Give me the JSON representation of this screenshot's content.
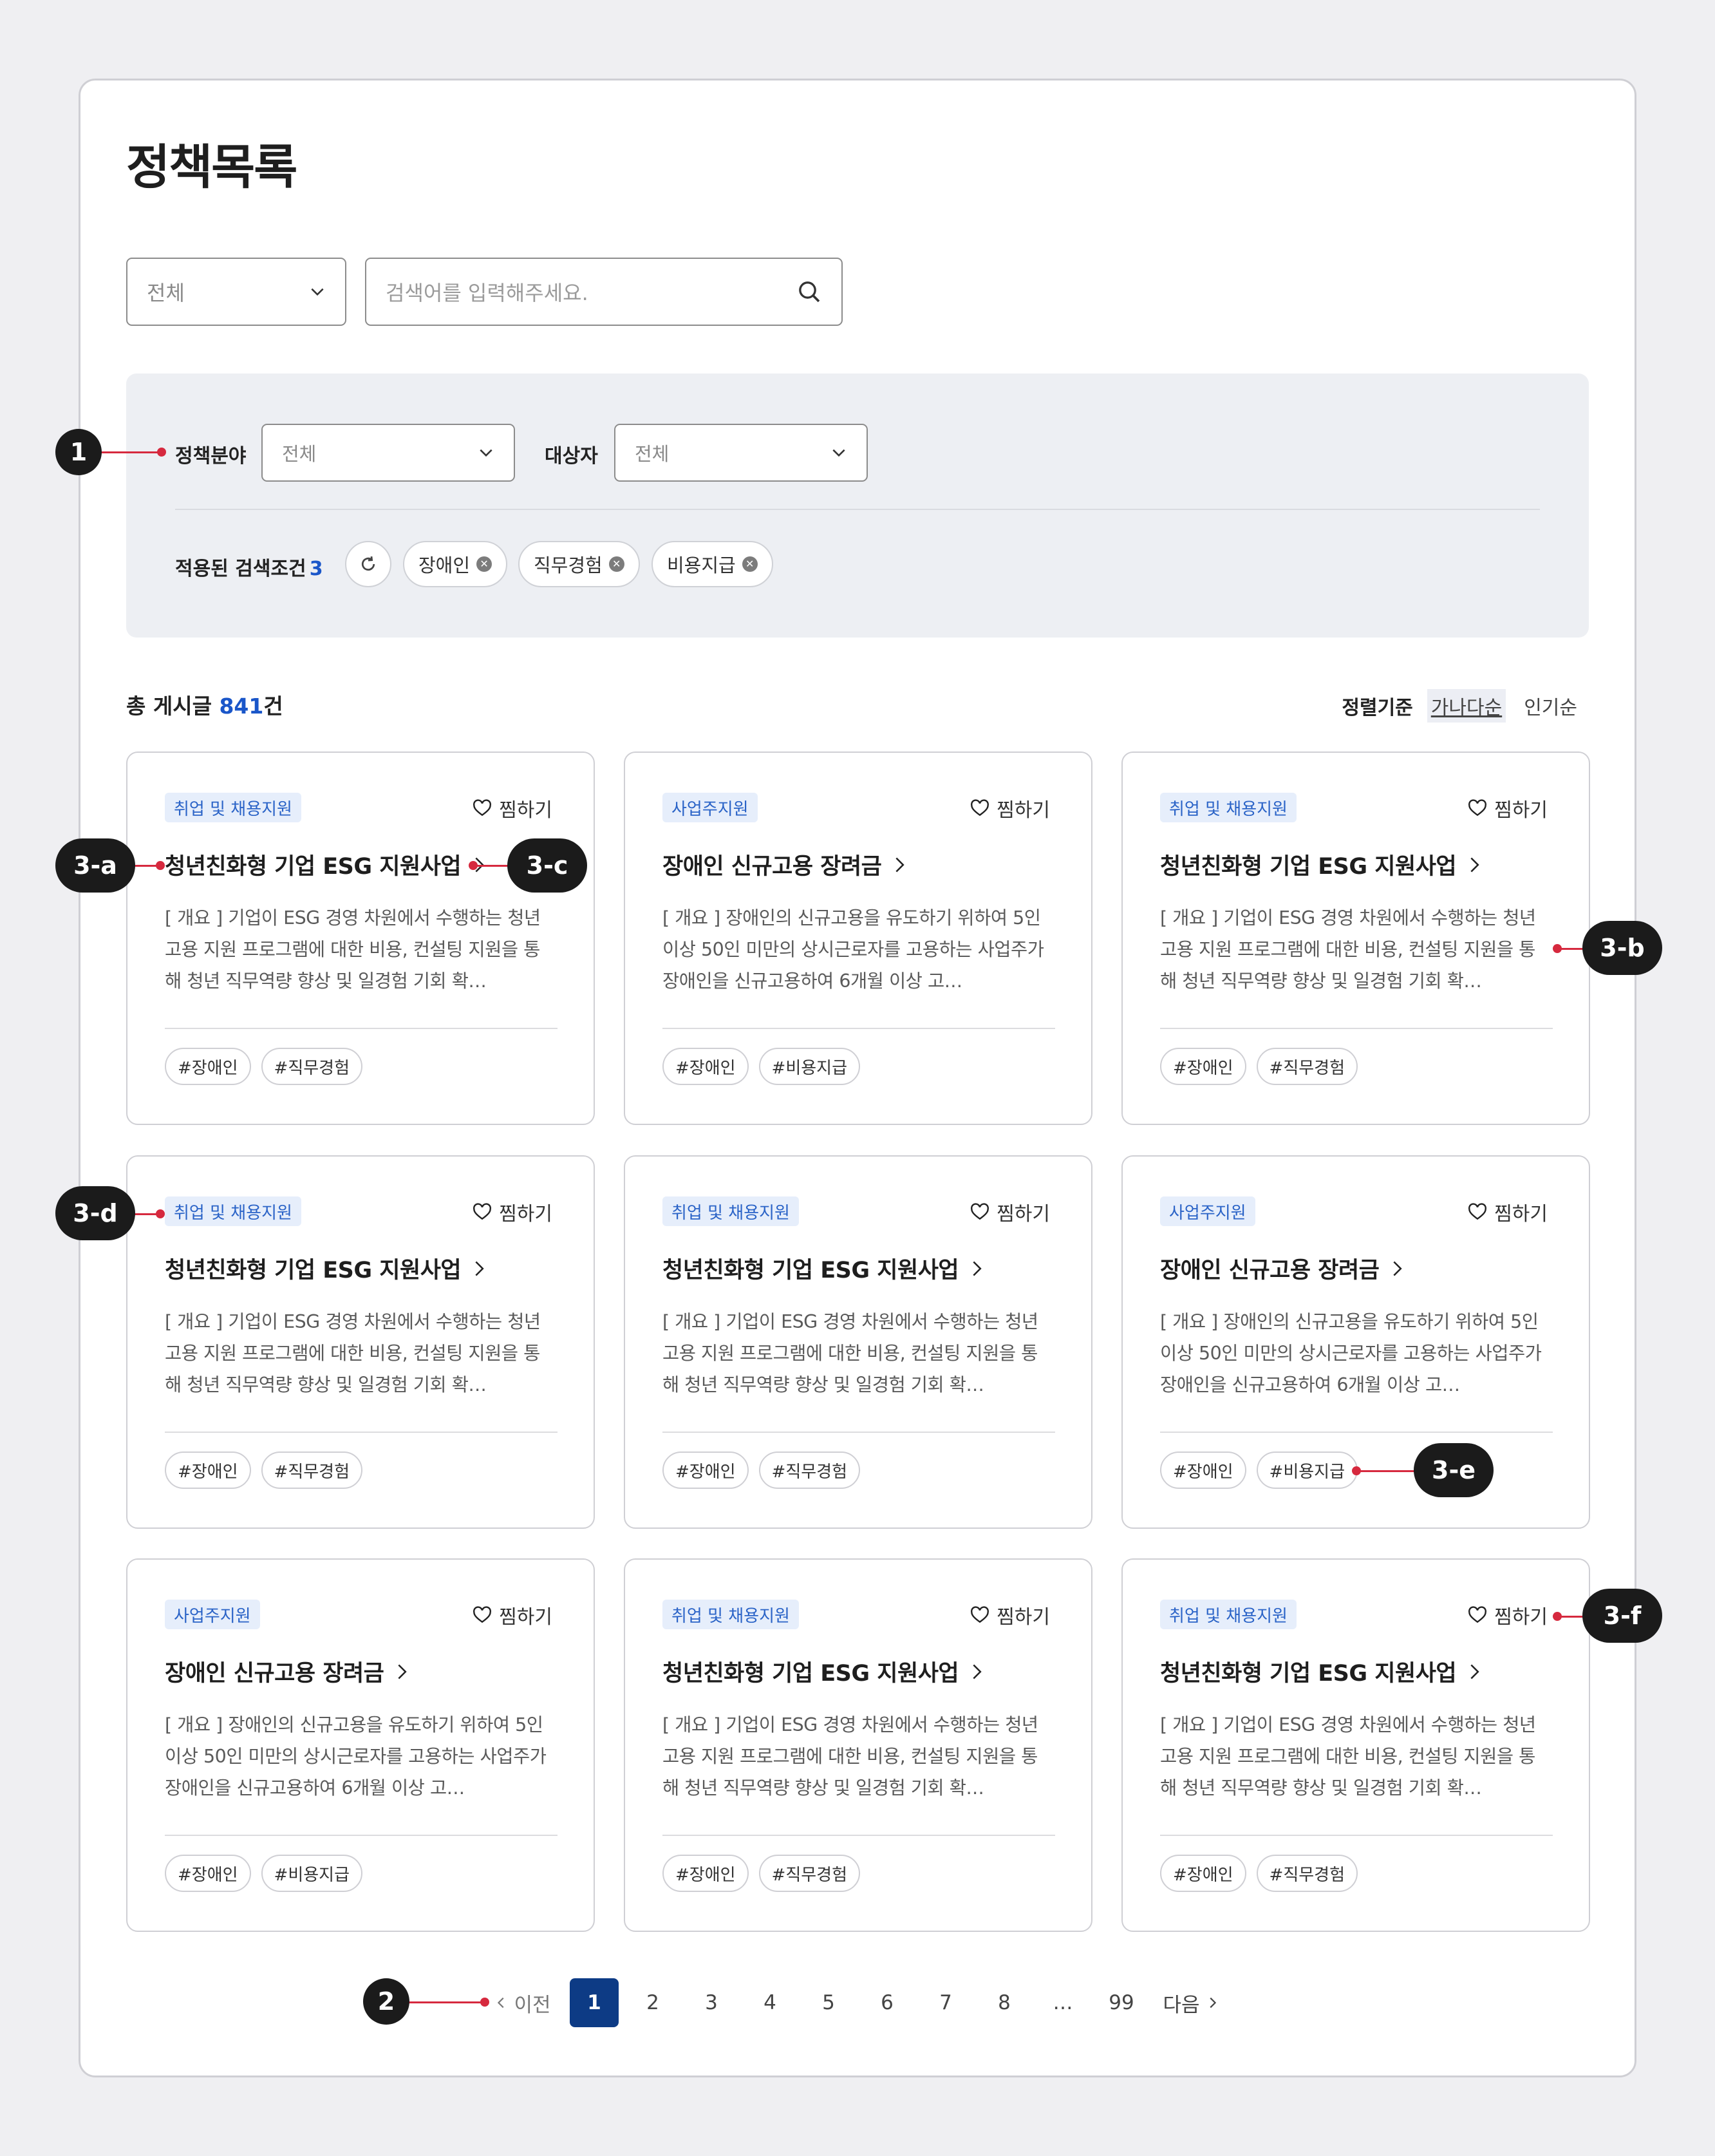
{
  "page": {
    "title": "정책목록"
  },
  "search": {
    "category_value": "전체",
    "placeholder": "검색어를 입력해주세요."
  },
  "filters": {
    "policy_field_label": "정책분야",
    "policy_field_value": "전체",
    "target_label": "대상자",
    "target_value": "전체",
    "applied_label": "적용된 검색조건",
    "applied_count": "3",
    "chips": [
      "장애인",
      "직무경험",
      "비용지급"
    ]
  },
  "summary": {
    "total_prefix": "총 게시글",
    "total_count": "841",
    "total_suffix": "건",
    "sort_label": "정렬기준",
    "sort_options": [
      "가나다순",
      "인기순"
    ],
    "sort_active": "가나다순"
  },
  "cards": [
    {
      "category": "취업 및 채용지원",
      "fav": "찜하기",
      "title": "청년친화형 기업 ESG 지원사업",
      "desc": "[ 개요 ] 기업이 ESG 경영 차원에서 수행하는 청년고용 지원 프로그램에 대한 비용, 컨설팅 지원을 통해 청년 직무역량 향상 및 일경험 기회 확…",
      "tags": [
        "#장애인",
        "#직무경험"
      ]
    },
    {
      "category": "사업주지원",
      "fav": "찜하기",
      "title": "장애인 신규고용 장려금",
      "desc": "[ 개요 ] 장애인의 신규고용을 유도하기 위하여 5인 이상 50인 미만의 상시근로자를 고용하는 사업주가 장애인을 신규고용하여 6개월 이상 고…",
      "tags": [
        "#장애인",
        "#비용지급"
      ]
    },
    {
      "category": "취업 및 채용지원",
      "fav": "찜하기",
      "title": "청년친화형 기업 ESG 지원사업",
      "desc": "[ 개요 ] 기업이 ESG 경영 차원에서 수행하는 청년고용 지원 프로그램에 대한 비용, 컨설팅 지원을 통해 청년 직무역량 향상 및 일경험 기회 확…",
      "tags": [
        "#장애인",
        "#직무경험"
      ]
    },
    {
      "category": "취업 및 채용지원",
      "fav": "찜하기",
      "title": "청년친화형 기업 ESG 지원사업",
      "desc": "[ 개요 ] 기업이 ESG 경영 차원에서 수행하는 청년고용 지원 프로그램에 대한 비용, 컨설팅 지원을 통해 청년 직무역량 향상 및 일경험 기회 확…",
      "tags": [
        "#장애인",
        "#직무경험"
      ]
    },
    {
      "category": "취업 및 채용지원",
      "fav": "찜하기",
      "title": "청년친화형 기업 ESG 지원사업",
      "desc": "[ 개요 ] 기업이 ESG 경영 차원에서 수행하는 청년고용 지원 프로그램에 대한 비용, 컨설팅 지원을 통해 청년 직무역량 향상 및 일경험 기회 확…",
      "tags": [
        "#장애인",
        "#직무경험"
      ]
    },
    {
      "category": "사업주지원",
      "fav": "찜하기",
      "title": "장애인 신규고용 장려금",
      "desc": "[ 개요 ] 장애인의 신규고용을 유도하기 위하여 5인 이상 50인 미만의 상시근로자를 고용하는 사업주가 장애인을 신규고용하여 6개월 이상 고…",
      "tags": [
        "#장애인",
        "#비용지급"
      ]
    },
    {
      "category": "사업주지원",
      "fav": "찜하기",
      "title": "장애인 신규고용 장려금",
      "desc": "[ 개요 ] 장애인의 신규고용을 유도하기 위하여 5인 이상 50인 미만의 상시근로자를 고용하는 사업주가 장애인을 신규고용하여 6개월 이상 고…",
      "tags": [
        "#장애인",
        "#비용지급"
      ]
    },
    {
      "category": "취업 및 채용지원",
      "fav": "찜하기",
      "title": "청년친화형 기업 ESG 지원사업",
      "desc": "[ 개요 ] 기업이 ESG 경영 차원에서 수행하는 청년고용 지원 프로그램에 대한 비용, 컨설팅 지원을 통해 청년 직무역량 향상 및 일경험 기회 확…",
      "tags": [
        "#장애인",
        "#직무경험"
      ]
    },
    {
      "category": "취업 및 채용지원",
      "fav": "찜하기",
      "title": "청년친화형 기업 ESG 지원사업",
      "desc": "[ 개요 ] 기업이 ESG 경영 차원에서 수행하는 청년고용 지원 프로그램에 대한 비용, 컨설팅 지원을 통해 청년 직무역량 향상 및 일경험 기회 확…",
      "tags": [
        "#장애인",
        "#직무경험"
      ]
    }
  ],
  "pagination": {
    "prev": "이전",
    "next": "다음",
    "pages": [
      "1",
      "2",
      "3",
      "4",
      "5",
      "6",
      "7",
      "8",
      "…",
      "99"
    ],
    "current": "1"
  },
  "annotations": [
    "1",
    "2",
    "3-a",
    "3-b",
    "3-c",
    "3-d",
    "3-e",
    "3-f"
  ],
  "colors": {
    "accent": "#1a56c9",
    "primary_dark": "#0d3b85",
    "marker": "#1b1b1b",
    "marker_line": "#d6293e",
    "tag_bg": "#e6eefb"
  }
}
